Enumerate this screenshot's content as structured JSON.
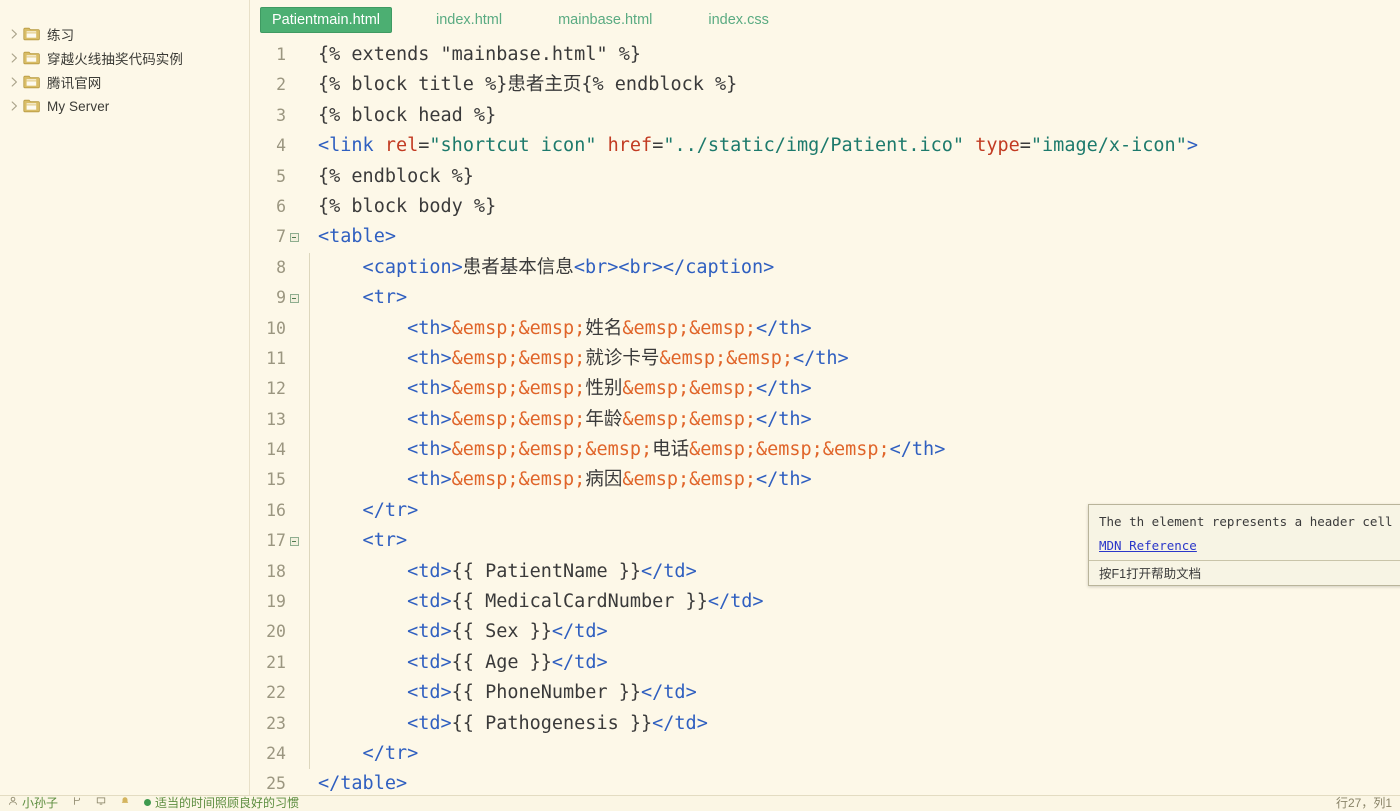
{
  "sidebar": {
    "items": [
      {
        "label": "练习",
        "icon": "folder-icon",
        "arrow": "chevron-right-icon"
      },
      {
        "label": "穿越火线抽奖代码实例",
        "icon": "folder-icon",
        "arrow": "chevron-right-icon"
      },
      {
        "label": "腾讯官网",
        "icon": "folder-icon",
        "arrow": "chevron-right-icon"
      },
      {
        "label": "My Server",
        "icon": "folder-icon",
        "arrow": "chevron-right-icon"
      }
    ]
  },
  "tabs": [
    {
      "label": "Patientmain.html",
      "active": true
    },
    {
      "label": "index.html",
      "active": false
    },
    {
      "label": "mainbase.html",
      "active": false
    },
    {
      "label": "index.css",
      "active": false
    }
  ],
  "editor": {
    "filename": "Patientmain.html",
    "language": "html",
    "lines": [
      {
        "num": "1",
        "fold": false,
        "guide": false,
        "tokens": [
          {
            "t": "{% extends ",
            "c": "plain"
          },
          {
            "t": "\"mainbase.html\"",
            "c": "plain"
          },
          {
            "t": " %}",
            "c": "plain"
          }
        ]
      },
      {
        "num": "2",
        "fold": false,
        "guide": false,
        "tokens": [
          {
            "t": "{% block title %}",
            "c": "plain"
          },
          {
            "t": "患者主页",
            "c": "cn"
          },
          {
            "t": "{% endblock %}",
            "c": "plain"
          }
        ]
      },
      {
        "num": "3",
        "fold": false,
        "guide": false,
        "tokens": [
          {
            "t": "{% block head %}",
            "c": "plain"
          }
        ]
      },
      {
        "num": "4",
        "fold": false,
        "guide": false,
        "tokens": [
          {
            "t": "<link",
            "c": "tag"
          },
          {
            "t": " ",
            "c": "plain"
          },
          {
            "t": "rel",
            "c": "attr"
          },
          {
            "t": "=",
            "c": "op"
          },
          {
            "t": "\"shortcut icon\"",
            "c": "str"
          },
          {
            "t": " ",
            "c": "plain"
          },
          {
            "t": "href",
            "c": "attr"
          },
          {
            "t": "=",
            "c": "op"
          },
          {
            "t": "\"../static/img/Patient.ico\"",
            "c": "str"
          },
          {
            "t": " ",
            "c": "plain"
          },
          {
            "t": "type",
            "c": "attr"
          },
          {
            "t": "=",
            "c": "op"
          },
          {
            "t": "\"image/x-icon\"",
            "c": "str"
          },
          {
            "t": ">",
            "c": "tag"
          }
        ]
      },
      {
        "num": "5",
        "fold": false,
        "guide": false,
        "tokens": [
          {
            "t": "{% endblock %}",
            "c": "plain"
          }
        ]
      },
      {
        "num": "6",
        "fold": false,
        "guide": false,
        "tokens": [
          {
            "t": "{% block body %}",
            "c": "plain"
          }
        ]
      },
      {
        "num": "7",
        "fold": true,
        "guide": false,
        "tokens": [
          {
            "t": "<table>",
            "c": "tag"
          }
        ]
      },
      {
        "num": "8",
        "fold": false,
        "guide": true,
        "tokens": [
          {
            "t": "    <caption>",
            "c": "tag"
          },
          {
            "t": "患者基本信息",
            "c": "cn"
          },
          {
            "t": "<br><br></caption>",
            "c": "tag"
          }
        ]
      },
      {
        "num": "9",
        "fold": true,
        "guide": true,
        "tokens": [
          {
            "t": "    <tr>",
            "c": "tag"
          }
        ]
      },
      {
        "num": "10",
        "fold": false,
        "guide": true,
        "tokens": [
          {
            "t": "        <th>",
            "c": "tag"
          },
          {
            "t": "&emsp;&emsp;",
            "c": "ent"
          },
          {
            "t": "姓名",
            "c": "cn"
          },
          {
            "t": "&emsp;&emsp;",
            "c": "ent"
          },
          {
            "t": "</th>",
            "c": "tag"
          }
        ]
      },
      {
        "num": "11",
        "fold": false,
        "guide": true,
        "tokens": [
          {
            "t": "        <th>",
            "c": "tag"
          },
          {
            "t": "&emsp;&emsp;",
            "c": "ent"
          },
          {
            "t": "就诊卡号",
            "c": "cn"
          },
          {
            "t": "&emsp;&emsp;",
            "c": "ent"
          },
          {
            "t": "</th>",
            "c": "tag"
          }
        ]
      },
      {
        "num": "12",
        "fold": false,
        "guide": true,
        "tokens": [
          {
            "t": "        <th>",
            "c": "tag"
          },
          {
            "t": "&emsp;&emsp;",
            "c": "ent"
          },
          {
            "t": "性别",
            "c": "cn"
          },
          {
            "t": "&emsp;&emsp;",
            "c": "ent"
          },
          {
            "t": "</th>",
            "c": "tag"
          }
        ]
      },
      {
        "num": "13",
        "fold": false,
        "guide": true,
        "tokens": [
          {
            "t": "        <th>",
            "c": "tag"
          },
          {
            "t": "&emsp;&emsp;",
            "c": "ent"
          },
          {
            "t": "年龄",
            "c": "cn"
          },
          {
            "t": "&emsp;&emsp;",
            "c": "ent"
          },
          {
            "t": "</th>",
            "c": "tag"
          }
        ]
      },
      {
        "num": "14",
        "fold": false,
        "guide": true,
        "tokens": [
          {
            "t": "        <th>",
            "c": "tag"
          },
          {
            "t": "&emsp;&emsp;&emsp;",
            "c": "ent"
          },
          {
            "t": "电话",
            "c": "cn"
          },
          {
            "t": "&emsp;&emsp;&emsp;",
            "c": "ent"
          },
          {
            "t": "</th>",
            "c": "tag"
          }
        ]
      },
      {
        "num": "15",
        "fold": false,
        "guide": true,
        "tokens": [
          {
            "t": "        <th>",
            "c": "tag"
          },
          {
            "t": "&emsp;&emsp;",
            "c": "ent"
          },
          {
            "t": "病因",
            "c": "cn"
          },
          {
            "t": "&emsp;&emsp;",
            "c": "ent"
          },
          {
            "t": "</th>",
            "c": "tag"
          }
        ]
      },
      {
        "num": "16",
        "fold": false,
        "guide": true,
        "tokens": [
          {
            "t": "    </tr>",
            "c": "tag"
          }
        ]
      },
      {
        "num": "17",
        "fold": true,
        "guide": true,
        "tokens": [
          {
            "t": "    <tr>",
            "c": "tag"
          }
        ]
      },
      {
        "num": "18",
        "fold": false,
        "guide": true,
        "tokens": [
          {
            "t": "        <td>",
            "c": "tag"
          },
          {
            "t": "{{ PatientName }}",
            "c": "plain"
          },
          {
            "t": "</td>",
            "c": "tag"
          }
        ]
      },
      {
        "num": "19",
        "fold": false,
        "guide": true,
        "tokens": [
          {
            "t": "        <td>",
            "c": "tag"
          },
          {
            "t": "{{ MedicalCardNumber }}",
            "c": "plain"
          },
          {
            "t": "</td>",
            "c": "tag"
          }
        ]
      },
      {
        "num": "20",
        "fold": false,
        "guide": true,
        "tokens": [
          {
            "t": "        <td>",
            "c": "tag"
          },
          {
            "t": "{{ Sex }}",
            "c": "plain"
          },
          {
            "t": "</td>",
            "c": "tag"
          }
        ]
      },
      {
        "num": "21",
        "fold": false,
        "guide": true,
        "tokens": [
          {
            "t": "        <td>",
            "c": "tag"
          },
          {
            "t": "{{ Age }}",
            "c": "plain"
          },
          {
            "t": "</td>",
            "c": "tag"
          }
        ]
      },
      {
        "num": "22",
        "fold": false,
        "guide": true,
        "tokens": [
          {
            "t": "        <td>",
            "c": "tag"
          },
          {
            "t": "{{ PhoneNumber }}",
            "c": "plain"
          },
          {
            "t": "</td>",
            "c": "tag"
          }
        ]
      },
      {
        "num": "23",
        "fold": false,
        "guide": true,
        "tokens": [
          {
            "t": "        <td>",
            "c": "tag"
          },
          {
            "t": "{{ Pathogenesis }}",
            "c": "plain"
          },
          {
            "t": "</td>",
            "c": "tag"
          }
        ]
      },
      {
        "num": "24",
        "fold": false,
        "guide": true,
        "tokens": [
          {
            "t": "    </tr>",
            "c": "tag"
          }
        ]
      },
      {
        "num": "25",
        "fold": false,
        "guide": false,
        "tokens": [
          {
            "t": "</table>",
            "c": "tag"
          }
        ]
      }
    ]
  },
  "doc_popup": {
    "description": "The th element represents a header cell in a table.",
    "link_label": "MDN Reference",
    "footer_hint": "按F1打开帮助文档",
    "gear_icon": "gear-icon"
  },
  "statusbar": {
    "left_items": [
      {
        "icon": "user-icon",
        "label": "小孙子"
      },
      {
        "icon": "branch-icon",
        "label": ""
      },
      {
        "icon": "monitor-icon",
        "label": ""
      },
      {
        "icon": "bell-icon",
        "label": ""
      }
    ],
    "status_label": "适当的时间照顾良好的习惯",
    "right_label": "行27，列1"
  },
  "colors": {
    "editor_bg": "#fdf8e8",
    "tab_active_bg": "#4caf72",
    "tab_inactive_fg": "#5aab82",
    "tag": "#2f5fc0",
    "attr": "#c23b22",
    "string": "#1d7a6c",
    "entity": "#e0652a",
    "gutter": "#9b9680",
    "folder": "#d4b45e"
  }
}
